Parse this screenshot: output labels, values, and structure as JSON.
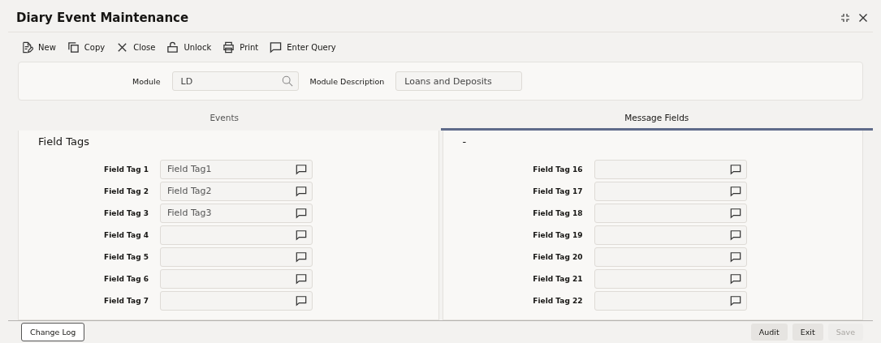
{
  "window": {
    "title": "Diary Event Maintenance"
  },
  "toolbar": [
    {
      "label": "New",
      "kind": "new"
    },
    {
      "label": "Copy",
      "kind": "copy"
    },
    {
      "label": "Close",
      "kind": "close"
    },
    {
      "label": "Unlock",
      "kind": "unlock"
    },
    {
      "label": "Print",
      "kind": "print"
    },
    {
      "label": "Enter Query",
      "kind": "query"
    }
  ],
  "header_fields": [
    {
      "label": "Module",
      "value": "LD",
      "kind": "search"
    },
    {
      "label": "Module Description",
      "value": "Loans and Deposits",
      "kind": "text"
    }
  ],
  "tabs": [
    {
      "label": "Events",
      "selected": false
    },
    {
      "label": "Message Fields",
      "selected": true
    }
  ],
  "panels": [
    {
      "heading": "Field Tags",
      "fields": [
        {
          "label": "Field Tag 1",
          "value": "Field Tag1"
        },
        {
          "label": "Field Tag 2",
          "value": "Field Tag2"
        },
        {
          "label": "Field Tag 3",
          "value": "Field Tag3"
        },
        {
          "label": "Field Tag 4"
        },
        {
          "label": "Field Tag 5"
        },
        {
          "label": "Field Tag 6"
        },
        {
          "label": "Field Tag 7"
        }
      ]
    },
    {
      "heading": "-",
      "fields": [
        {
          "label": "Field Tag 16"
        },
        {
          "label": "Field Tag 17"
        },
        {
          "label": "Field Tag 18"
        },
        {
          "label": "Field Tag 19"
        },
        {
          "label": "Field Tag 20"
        },
        {
          "label": "Field Tag 21"
        },
        {
          "label": "Field Tag 22"
        }
      ]
    }
  ],
  "footer": {
    "left_buttons": [
      {
        "label": "Change Log",
        "disabled": false
      }
    ],
    "right_buttons": [
      {
        "label": "Audit",
        "disabled": false
      },
      {
        "label": "Exit",
        "disabled": false
      },
      {
        "label": "Save",
        "disabled": true
      }
    ]
  }
}
